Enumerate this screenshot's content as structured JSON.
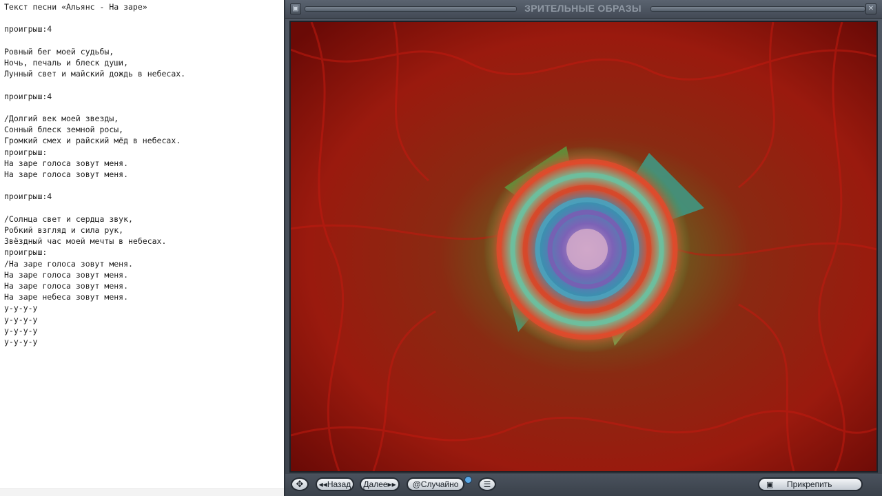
{
  "editor": {
    "lyrics_text": "Текст песни «Альянс - На заре»\n\nпроигрыш:4\n\nРовный бег моей судьбы,\nНочь, печаль и блеск души,\nЛунный свет и майский дождь в небесах.\n\nпроигрыш:4\n\n/Долгий век моей звезды,\nСонный блеск земной росы,\nГромкий смех и райский мёд в небесах.\nпроигрыш:\nНа заре голоса зовут меня.\nНа заре голоса зовут меня.\n\nпроигрыш:4\n\n/Солнца свет и сердца звук,\nРобкий взгляд и сила рук,\nЗвёздный час моей мечты в небесах.\nпроигрыш:\n/На заре голоса зовут меня.\nНа заре голоса зовут меня.\nНа заре голоса зовут меня.\nНа заре небеса зовут меня.\nу-у-у-у\nу-у-у-у\nу-у-у-у\nу-у-у-у"
  },
  "window": {
    "title": "ЗРИТЕЛЬНЫЕ ОБРАЗЫ",
    "system_icon": "▣",
    "close_icon": "✕"
  },
  "controls": {
    "nav_icon": "✥",
    "back_label": "◂◂Назад",
    "next_label": "Далее▸▸",
    "random_label": "@Случайно",
    "menu_icon": "☰",
    "pin_icon": "▣",
    "pin_label": "Прикрепить"
  },
  "colors": {
    "background_red": "#7a0e08",
    "window_frame": "#4a525d"
  }
}
